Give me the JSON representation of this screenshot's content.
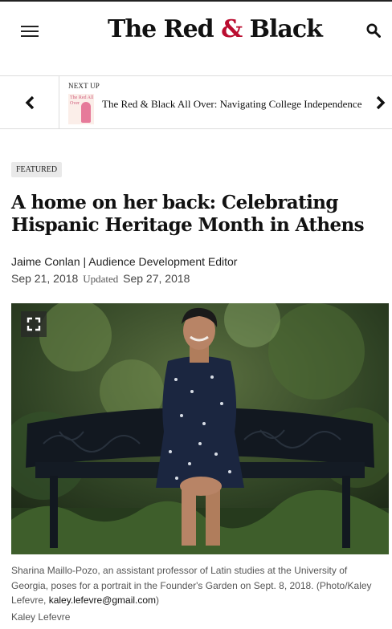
{
  "header": {
    "logo_left": "The Red ",
    "logo_amp": "&",
    "logo_right": " Black"
  },
  "next_up": {
    "label": "NEXT UP",
    "title": "The Red & Black All Over: Navigating College Independence",
    "thumb_text": "The Red All Over"
  },
  "article": {
    "tag": "FEATURED",
    "headline": "A home on her back: Celebrating Hispanic Heritage Month in Athens",
    "author": "Jaime Conlan",
    "role": " | Audience Development Editor",
    "published": "Sep 21, 2018",
    "updated_label": "Updated",
    "updated": "Sep 27, 2018"
  },
  "photo": {
    "caption_text": "Sharina Maillo-Pozo, an assistant professor of Latin studies at the University of Georgia, poses for a portrait in the Founder's Garden on Sept. 8, 2018. (Photo/Kaley Lefevre, ",
    "caption_email": "kaley.lefevre@gmail.com",
    "caption_end": ")",
    "credit": "Kaley Lefevre"
  },
  "colors": {
    "brand_red": "#ba0c2f",
    "text": "#222222"
  },
  "icons": {
    "menu": "hamburger-menu-icon",
    "search": "search-icon",
    "prev": "chevron-left-icon",
    "next": "chevron-right-icon",
    "expand": "expand-icon"
  }
}
